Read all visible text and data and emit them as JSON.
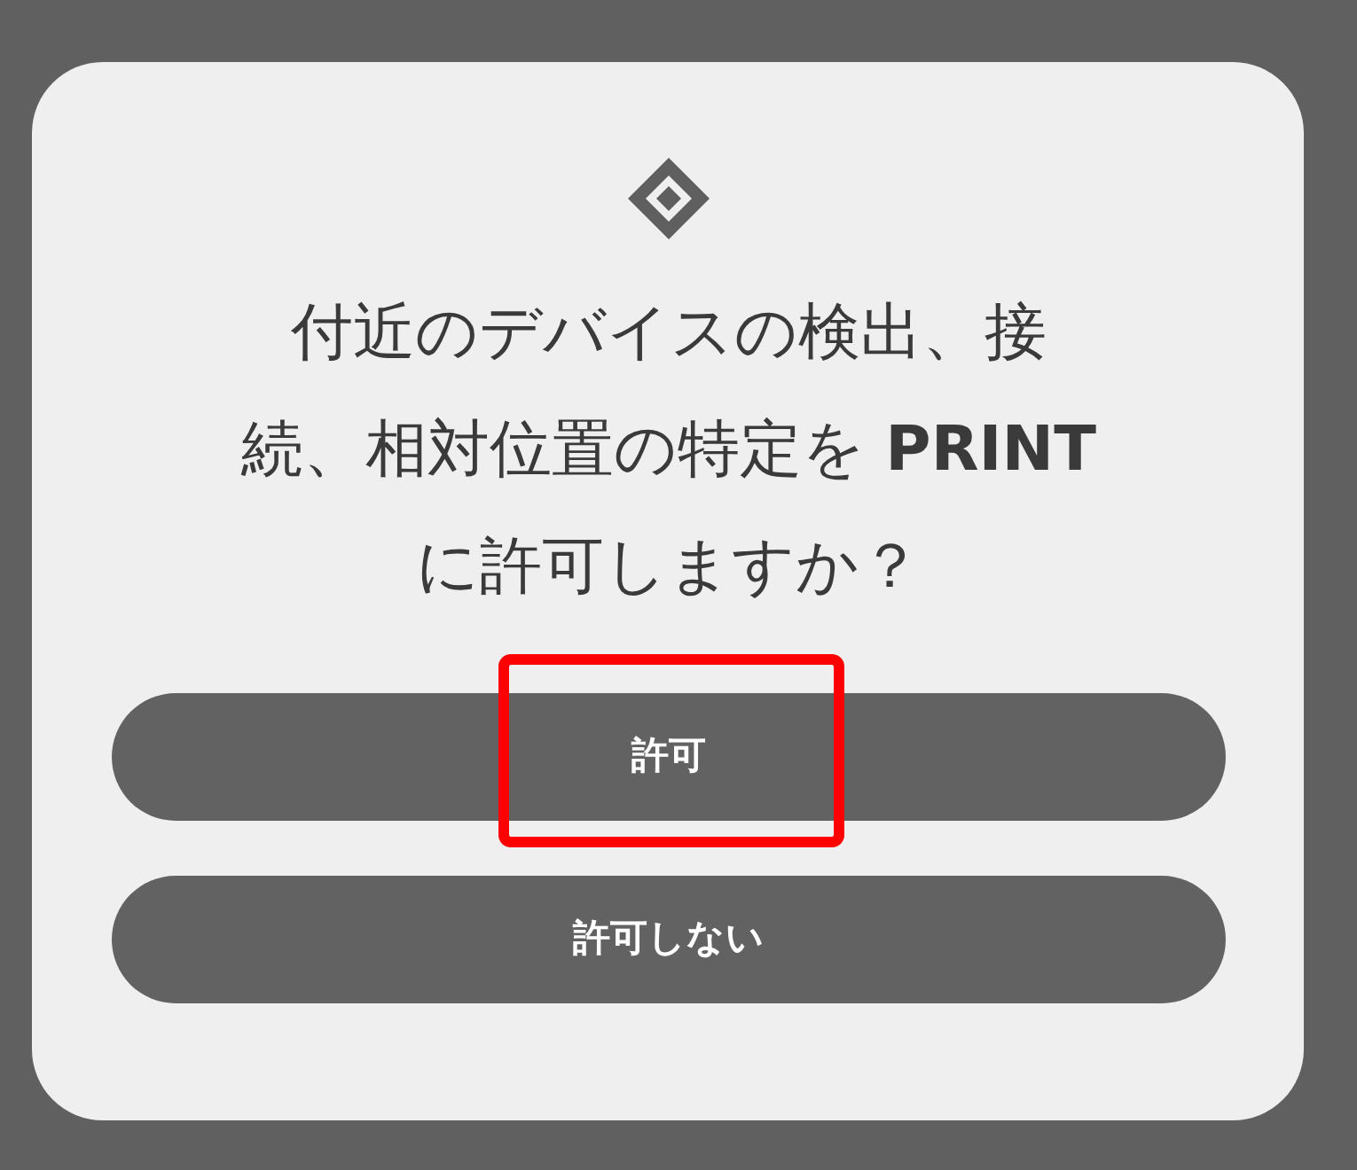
{
  "dialog": {
    "message": "付近のデバイスの検出、接続、相対位置の特定を **PRINT** に許可しますか？",
    "buttons": [
      {
        "label": "許可",
        "highlighted": true
      },
      {
        "label": "許可しない",
        "highlighted": false
      }
    ]
  }
}
